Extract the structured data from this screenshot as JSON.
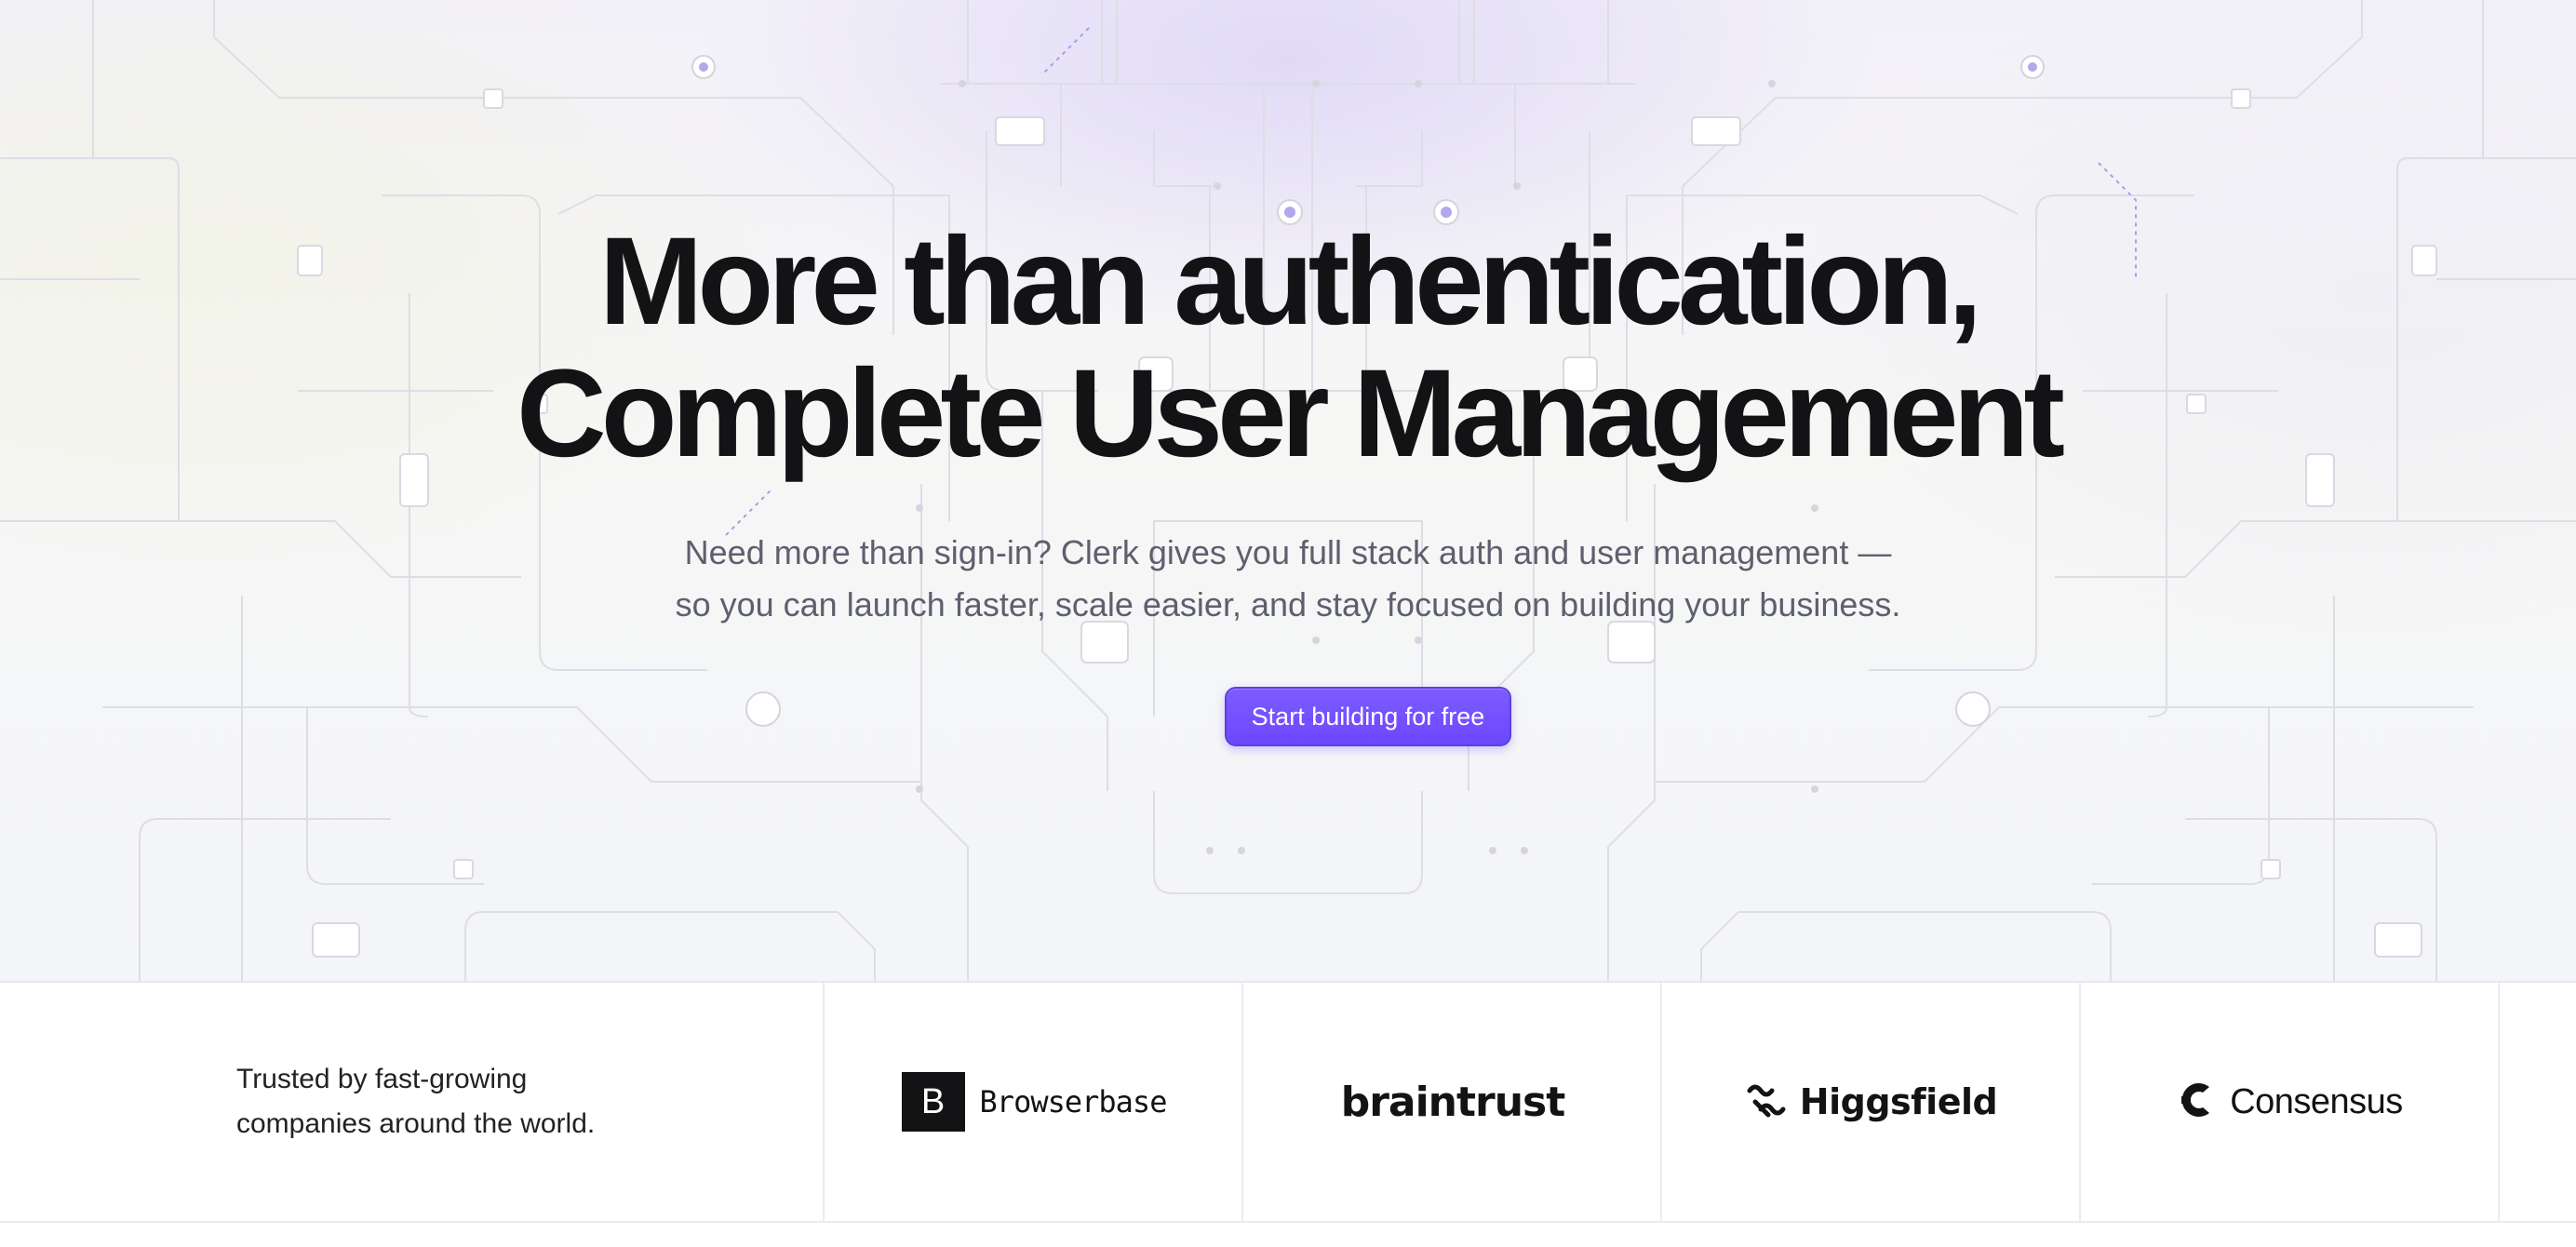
{
  "hero": {
    "title_line1": "More than authentication,",
    "title_line2": "Complete User Management",
    "subtitle_line1": "Need more than sign-in? Clerk gives you full stack auth and user management —",
    "subtitle_line2": "so you can launch faster, scale easier, and stay focused on building your business.",
    "cta_label": "Start building for free"
  },
  "trusted": {
    "text_line1": "Trusted by fast-growing",
    "text_line2": "companies around the world.",
    "logos": [
      {
        "name": "Browserbase",
        "mark": "B",
        "icon": "browserbase-logo"
      },
      {
        "name": "braintrust",
        "icon": "braintrust-logo"
      },
      {
        "name": "Higgsfield",
        "icon": "higgsfield-icon"
      },
      {
        "name": "Consensus",
        "icon": "consensus-icon"
      }
    ]
  },
  "colors": {
    "accent": "#6c47ff",
    "heading": "#131316",
    "subtitle": "#5e5f6e",
    "circuit_line": "#dcdbe4"
  }
}
